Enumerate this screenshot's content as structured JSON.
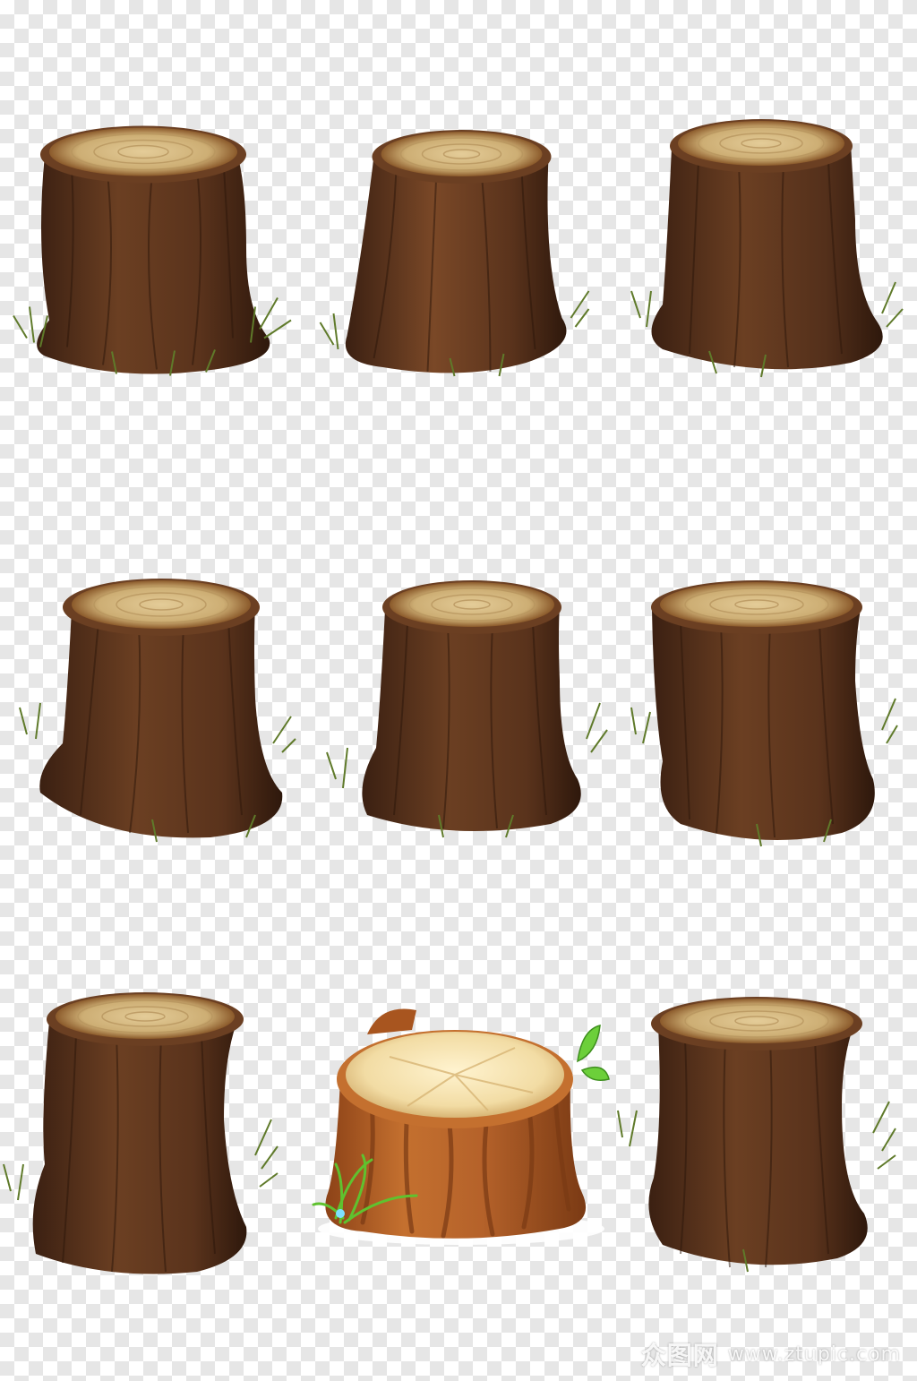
{
  "image": {
    "background": "transparent-checkerboard",
    "subject": "tree stumps",
    "stump_count": 9,
    "colors": {
      "bark_dark": "#4a2a17",
      "bark_mid": "#6b3f22",
      "bark_light": "#8a5a36",
      "cut_face": "#d9bf8a",
      "cut_rings": "#b8965f",
      "grass": "#5f7a2a",
      "cartoon_bark": "#b8652a",
      "cartoon_top": "#f6e6b8",
      "cartoon_leaf": "#6ccf3a"
    }
  },
  "watermark": {
    "logo": "众图网",
    "url": "www.ztupic.com"
  }
}
